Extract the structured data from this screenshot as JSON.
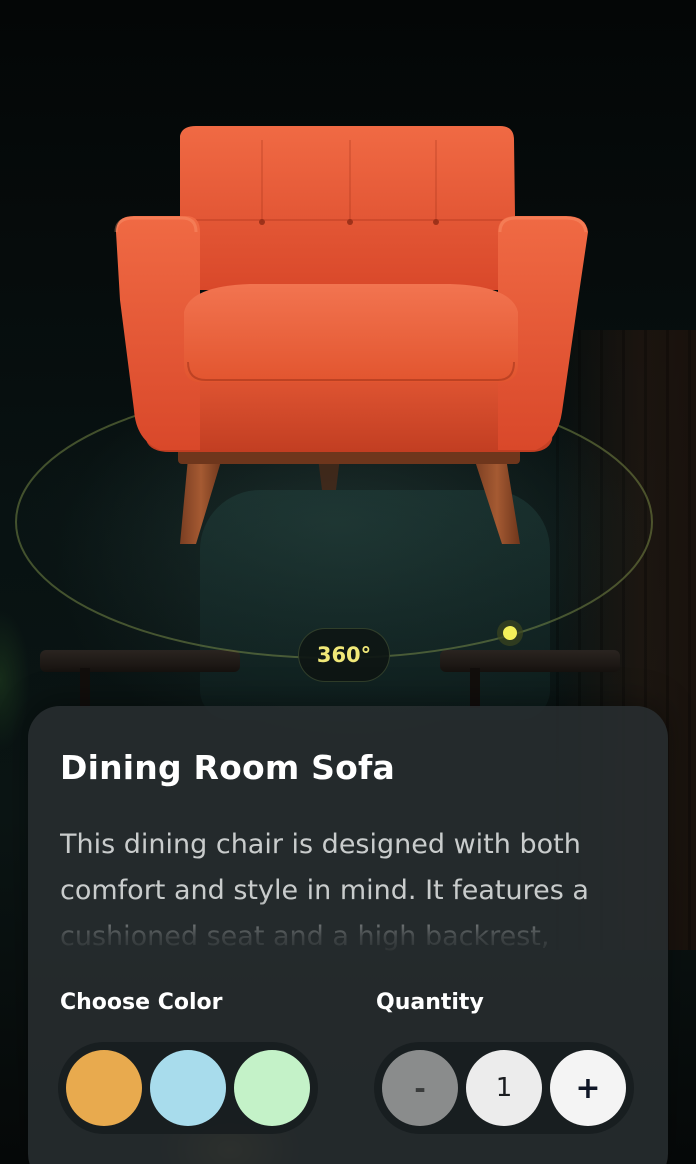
{
  "product": {
    "title": "Dining Room Sofa",
    "description": "This dining chair is designed with both comfort and style in mind. It features a cushioned seat and a high backrest,",
    "rotation_label": "360°"
  },
  "color_picker": {
    "label": "Choose Color",
    "options": [
      {
        "name": "orange",
        "hex": "#E8AA4E"
      },
      {
        "name": "light-blue",
        "hex": "#A8DCEC"
      },
      {
        "name": "mint-green",
        "hex": "#C4F2C8"
      }
    ]
  },
  "quantity": {
    "label": "Quantity",
    "minus": "-",
    "value": "1",
    "plus": "+"
  },
  "colors": {
    "accent": "#F3F05A",
    "card": "#282E30",
    "chair": "#E8502C"
  },
  "icons": {
    "rotation_handle": "orbit-handle-dot",
    "decrement": "minus-icon",
    "increment": "plus-icon"
  }
}
